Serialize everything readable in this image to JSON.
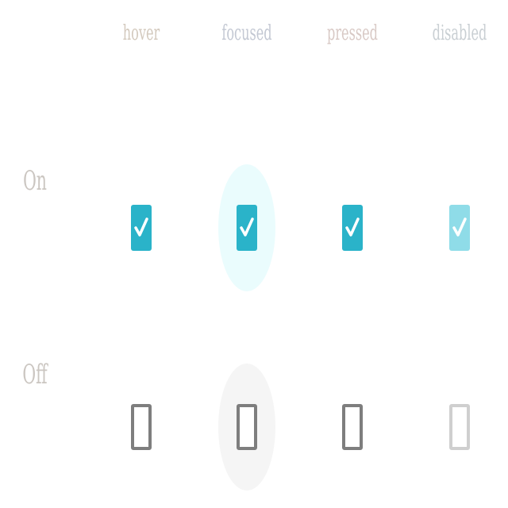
{
  "columns": {
    "hover": "hover",
    "focused": "focused",
    "pressed": "pressed",
    "disabled": "disabled"
  },
  "rows": {
    "on": "On",
    "off": "Off"
  },
  "checkboxes": [
    {
      "row": "On",
      "state": "hover",
      "checked": true
    },
    {
      "row": "On",
      "state": "focused",
      "checked": true
    },
    {
      "row": "On",
      "state": "pressed",
      "checked": true
    },
    {
      "row": "On",
      "state": "disabled",
      "checked": true
    },
    {
      "row": "Off",
      "state": "hover",
      "checked": false
    },
    {
      "row": "Off",
      "state": "focused",
      "checked": false
    },
    {
      "row": "Off",
      "state": "pressed",
      "checked": false
    },
    {
      "row": "Off",
      "state": "disabled",
      "checked": false
    }
  ],
  "colors": {
    "checked_fill": "#2ab3c9",
    "checked_disabled_fill": "#8fdce8",
    "unchecked_border": "#7e7e7e",
    "unchecked_disabled_border": "#cfcfcf",
    "focus_halo_on": "#eafcfd",
    "focus_halo_off": "#f5f5f5"
  },
  "icons": {
    "check": "checkmark-icon"
  }
}
